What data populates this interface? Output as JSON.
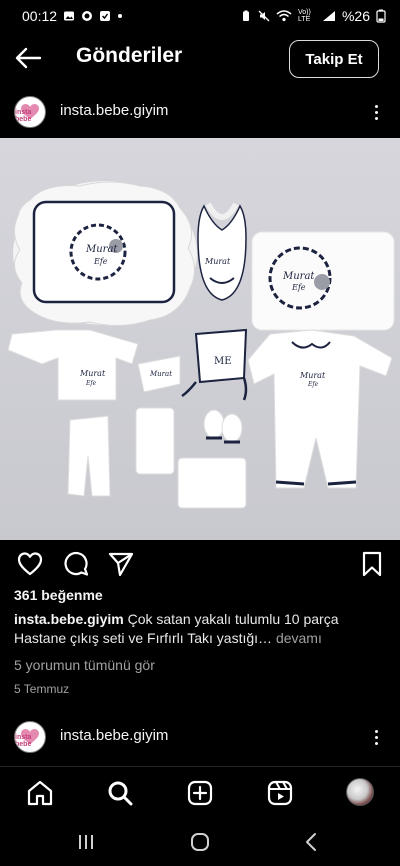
{
  "status_bar": {
    "time": "00:12",
    "battery_text": "%26",
    "volte_label": "Vo)) LTE"
  },
  "top_bar": {
    "title": "Gönderiler",
    "follow_label": "Takip Et"
  },
  "post": {
    "username": "insta.bebe.giyim",
    "avatar_logo_text": "insta bebe",
    "likes": "361 beğenme",
    "caption_user": "insta.bebe.giyim",
    "caption_text": "Çok satan yakalı tulumlu 10 parça Hastane çıkış seti ve Fırfırlı Takı yastığı…",
    "caption_more": "devamı",
    "comments_link": "5 yorumun tümünü gör",
    "date": "5 Temmuz",
    "image_embroidery": [
      "Murat",
      "Efe"
    ],
    "image_initials": "ME"
  },
  "next_post": {
    "username": "insta.bebe.giyim"
  },
  "icons": {
    "back": "arrow-left-icon",
    "like": "heart-icon",
    "comment": "comment-icon",
    "share": "paper-plane-icon",
    "save": "bookmark-icon",
    "home": "home-icon",
    "search": "search-icon",
    "create": "plus-square-icon",
    "reels": "reels-icon"
  },
  "colors": {
    "background": "#000000",
    "text": "#f5f5f5",
    "secondary_text": "#a0a0a0",
    "navy_trim": "#1c2340",
    "brand_pink": "#c2407a"
  }
}
